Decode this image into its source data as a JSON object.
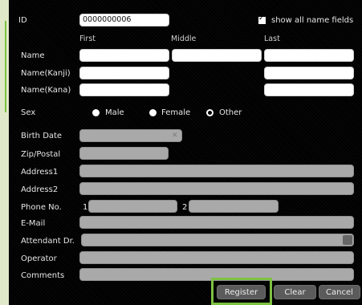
{
  "form": {
    "id_label": "ID",
    "id_value": "0000000006",
    "show_all_label": "show all name fields",
    "show_all_checked": true,
    "col_first": "First",
    "col_middle": "Middle",
    "col_last": "Last",
    "name_label": "Name",
    "name_kanji_label": "Name(Kanji)",
    "name_kana_label": "Name(Kana)",
    "sex_label": "Sex",
    "sex_options": [
      "Male",
      "Female",
      "Other"
    ],
    "sex_selected": "Other",
    "birth_label": "Birth Date",
    "zip_label": "Zip/Postal",
    "address1_label": "Address1",
    "address2_label": "Address2",
    "phone_label": "Phone No.",
    "phone_idx1": "1",
    "phone_idx2": "2",
    "email_label": "E-Mail",
    "attendant_label": "Attendant Dr.",
    "operator_label": "Operator",
    "comments_label": "Comments"
  },
  "buttons": {
    "register": "Register",
    "clear": "Clear",
    "cancel": "Cancel"
  },
  "icons": {
    "clear_date": "close-icon",
    "dropdown": "chevron-down-icon"
  },
  "colors": {
    "accent": "#7dc142",
    "background": "#000000",
    "outer": "#dfe9c9"
  }
}
